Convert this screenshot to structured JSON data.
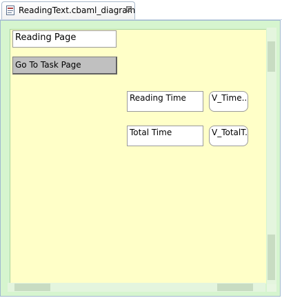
{
  "tab": {
    "title": "ReadingText.cbaml_diagram",
    "icon": "diagram-file-icon",
    "close_icon": "close-icon",
    "close_glyph": "⊠"
  },
  "diagram": {
    "page_title": "Reading Page",
    "go_button": "Go To Task Page",
    "reading_time_label": "Reading Time",
    "reading_time_var": "V_Time...",
    "total_time_label": "Total Time",
    "total_time_var": "V_TotalT..."
  },
  "colors": {
    "canvas": "#ffffc8",
    "frame": "#d6f5cf",
    "button": "#c0c0c0"
  }
}
